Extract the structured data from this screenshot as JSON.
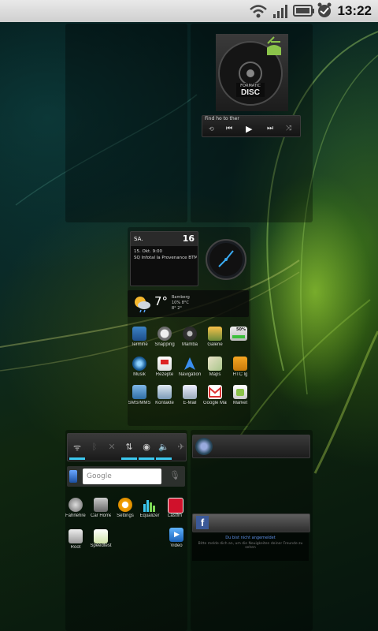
{
  "status_bar": {
    "time": "13:22"
  },
  "music_widget": {
    "album_art_title": "DISC",
    "album_art_caption": "FORMATIC",
    "track_title": "Find ho to ther"
  },
  "calendar_widget": {
    "day_abbr": "SA.",
    "date_number": "16",
    "event_line1": "15. Okt. 9:00",
    "event_line2": "SQ Infotal la Provenance BTMP"
  },
  "weather_widget": {
    "temperature": "7°",
    "location": "Bamberg",
    "detail1": "10% 8°C",
    "detail2": "8° 2°"
  },
  "app_grid": [
    [
      "Termine",
      "Snapping",
      "Mamba",
      "Galerie",
      "50%"
    ],
    [
      "Musik",
      "Rezepte",
      "Navigation",
      "Maps",
      "HTC lg"
    ],
    [
      "SMS/MMS",
      "Kontakte",
      "E-Mail",
      "Google Mail",
      "Market"
    ]
  ],
  "search_widget": {
    "placeholder": "Google"
  },
  "shortcuts": {
    "row1": [
      "Fahrlehrer",
      "Car Home",
      "Settings",
      "Equalizer",
      "Lastfm"
    ],
    "row2": [
      "Root",
      "Speedtest",
      "Video"
    ]
  },
  "facebook_widget": {
    "logo": "f",
    "line1": "Du bist nicht angemeldet",
    "line2": "Bitte melde dich an, um die Neuigkeiten deiner Freunde zu sehen"
  }
}
